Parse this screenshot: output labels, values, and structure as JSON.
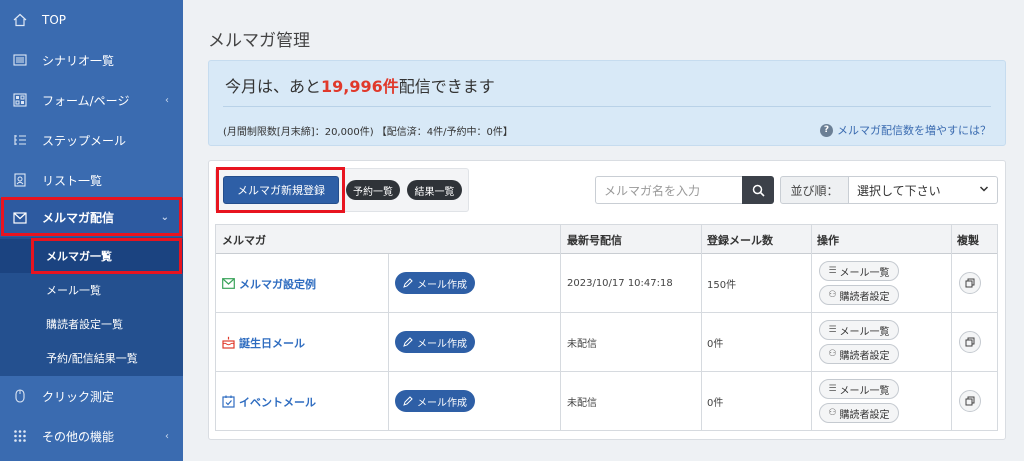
{
  "sidebar": {
    "items": [
      {
        "label": "TOP",
        "icon": "home-icon"
      },
      {
        "label": "シナリオ一覧",
        "icon": "list-icon"
      },
      {
        "label": "フォーム/ページ",
        "icon": "form-icon"
      },
      {
        "label": "ステップメール",
        "icon": "steps-icon"
      },
      {
        "label": "リスト一覧",
        "icon": "address-book-icon"
      },
      {
        "label": "メルマガ配信",
        "icon": "envelope-icon"
      },
      {
        "label": "クリック測定",
        "icon": "mouse-icon"
      },
      {
        "label": "その他の機能",
        "icon": "grid-dots-icon"
      }
    ],
    "sub_items": [
      {
        "label": "メルマガ一覧"
      },
      {
        "label": "メール一覧"
      },
      {
        "label": "購読者設定一覧"
      },
      {
        "label": "予約/配信結果一覧"
      }
    ]
  },
  "page": {
    "title": "メルマガ管理"
  },
  "info": {
    "prefix": "今月は、あと",
    "count": "19,996件",
    "suffix": "配信できます",
    "detail": "(月間制限数[月末締]：20,000件) 【配信済：4件/予約中：0件】",
    "help": "メルマガ配信数を増やすには？"
  },
  "toolbar": {
    "new_button": "メルマガ新規登録",
    "reserve_button": "予約一覧",
    "result_button": "結果一覧",
    "search_placeholder": "メルマガ名を入力",
    "sort_label": "並び順：",
    "sort_value": "選択して下さい"
  },
  "table": {
    "headers": [
      "メルマガ",
      "最新号配信",
      "登録メール数",
      "操作",
      "複製"
    ],
    "rows": [
      {
        "name": "メルマガ設定例",
        "icon": "envelope-icon",
        "compose": "メール作成",
        "latest": "2023/10/17 10:47:18",
        "count": "150件",
        "mail_list": "メール一覧",
        "subscriber": "購読者設定"
      },
      {
        "name": "誕生日メール",
        "icon": "cake-icon",
        "compose": "メール作成",
        "latest": "未配信",
        "count": "0件",
        "mail_list": "メール一覧",
        "subscriber": "購読者設定"
      },
      {
        "name": "イベントメール",
        "icon": "calendar-check-icon",
        "compose": "メール作成",
        "latest": "未配信",
        "count": "0件",
        "mail_list": "メール一覧",
        "subscriber": "購読者設定"
      }
    ]
  },
  "colors": {
    "sidebar": "#3a6bb0",
    "accent": "#2e5fa6",
    "highlight": "#e8141f",
    "count": "#e0392b"
  }
}
